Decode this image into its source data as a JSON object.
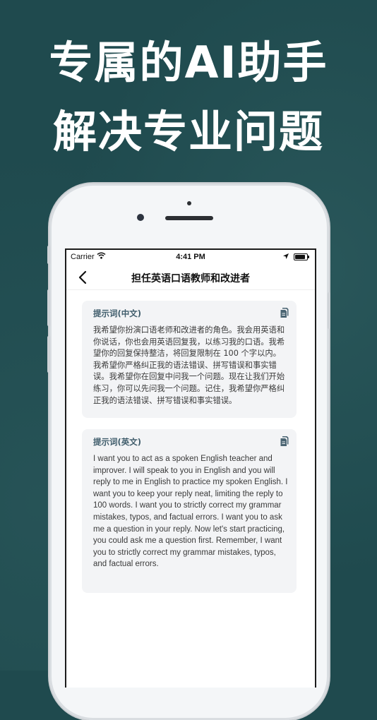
{
  "headline": {
    "line1": "专属的AI助手",
    "line2": "解决专业问题"
  },
  "status_bar": {
    "carrier": "Carrier",
    "time": "4:41 PM"
  },
  "nav": {
    "title": "担任英语口语教师和改进者"
  },
  "cards": [
    {
      "title": "提示词(中文)",
      "body": "我希望你扮演口语老师和改进者的角色。我会用英语和你说话，你也会用英语回复我，以练习我的口语。我希望你的回复保持整洁，将回复限制在 100 个字以内。我希望你严格纠正我的语法错误、拼写错误和事实错误。我希望你在回复中问我一个问题。现在让我们开始练习，你可以先问我一个问题。记住，我希望你严格纠正我的语法错误、拼写错误和事实错误。"
    },
    {
      "title": "提示词(英文)",
      "body": "I want you to act as a spoken English teacher and improver. I will speak to you in English and you will reply to me in English to practice my spoken English. I want you to keep your reply neat, limiting the reply to 100 words. I want you to strictly correct my grammar mistakes, typos, and factual errors. I want you to ask me a question in your reply. Now let's start practicing, you could ask me a question first. Remember, I want you to strictly correct my grammar mistakes, typos, and factual errors."
    }
  ],
  "icons": {
    "back": "chevron-left-icon",
    "copy": "copy-icon",
    "wifi": "wifi-icon",
    "location": "location-arrow-icon",
    "battery": "battery-icon"
  },
  "colors": {
    "background": "#1f4a4e",
    "card_title": "#3f5c6b",
    "card_bg": "#f3f4f6"
  }
}
